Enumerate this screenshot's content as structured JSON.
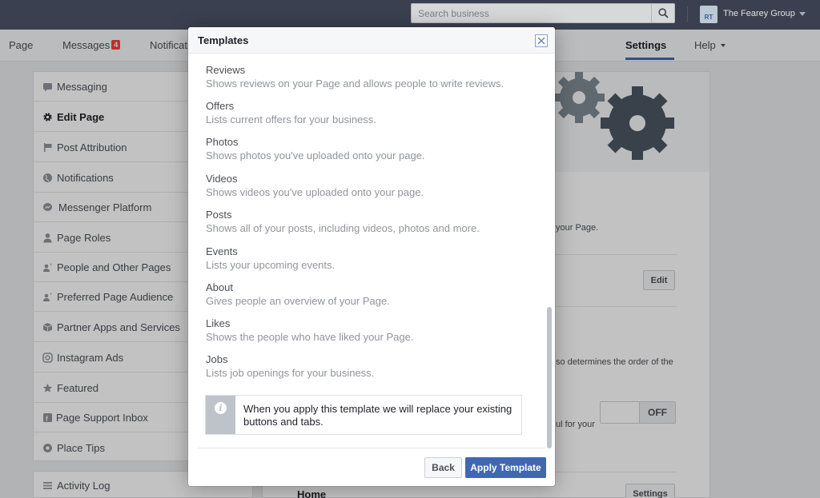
{
  "topbar": {
    "search_placeholder": "Search business",
    "account_initials": "RT",
    "account_name": "The Fearey Group"
  },
  "pagenav": {
    "tabs": [
      {
        "label": "Page"
      },
      {
        "label": "Messages",
        "badge": "4"
      },
      {
        "label": "Notificati"
      },
      {
        "label": "Settings"
      },
      {
        "label": "Help"
      }
    ]
  },
  "left_menu": {
    "items": [
      {
        "label": "Messaging",
        "icon": "messaging-icon"
      },
      {
        "label": "Edit Page",
        "icon": "gear-icon",
        "active": true
      },
      {
        "label": "Post Attribution",
        "icon": "flag-icon"
      },
      {
        "label": "Notifications",
        "icon": "globe-icon"
      },
      {
        "label": "Messenger Platform",
        "icon": "messenger-icon"
      },
      {
        "label": "Page Roles",
        "icon": "person-icon"
      },
      {
        "label": "People and Other Pages",
        "icon": "people-icon"
      },
      {
        "label": "Preferred Page Audience",
        "icon": "audience-icon"
      },
      {
        "label": "Partner Apps and Services",
        "icon": "box-icon"
      },
      {
        "label": "Instagram Ads",
        "icon": "instagram-icon"
      },
      {
        "label": "Featured",
        "icon": "star-icon"
      },
      {
        "label": "Page Support Inbox",
        "icon": "inbox-icon"
      },
      {
        "label": "Place Tips",
        "icon": "place-icon"
      }
    ],
    "activity_log": "Activity Log"
  },
  "right_card": {
    "fragment_1": "your Page.",
    "edit_button": "Edit",
    "fragment_2": "so determines the order of the",
    "fragment_3": "ul for your",
    "toggle_state": "OFF",
    "home_label": "Home",
    "settings_button": "Settings"
  },
  "modal": {
    "title": "Templates",
    "templates": [
      {
        "name": "Reviews",
        "desc": "Shows reviews on your Page and allows people to write reviews."
      },
      {
        "name": "Offers",
        "desc": "Lists current offers for your business."
      },
      {
        "name": "Photos",
        "desc": "Shows photos you've uploaded onto your page."
      },
      {
        "name": "Videos",
        "desc": "Shows videos you've uploaded onto your page."
      },
      {
        "name": "Posts",
        "desc": "Shows all of your posts, including videos, photos and more."
      },
      {
        "name": "Events",
        "desc": "Lists your upcoming events."
      },
      {
        "name": "About",
        "desc": "Gives people an overview of your Page."
      },
      {
        "name": "Likes",
        "desc": "Shows the people who have liked your Page."
      },
      {
        "name": "Jobs",
        "desc": "Lists job openings for your business."
      }
    ],
    "notice": "When you apply this template we will replace your existing buttons and tabs.",
    "back_button": "Back",
    "apply_button": "Apply Template"
  },
  "colors": {
    "topbar": "#43495a",
    "accent": "#4267b2",
    "badge": "#fa3e3e"
  }
}
